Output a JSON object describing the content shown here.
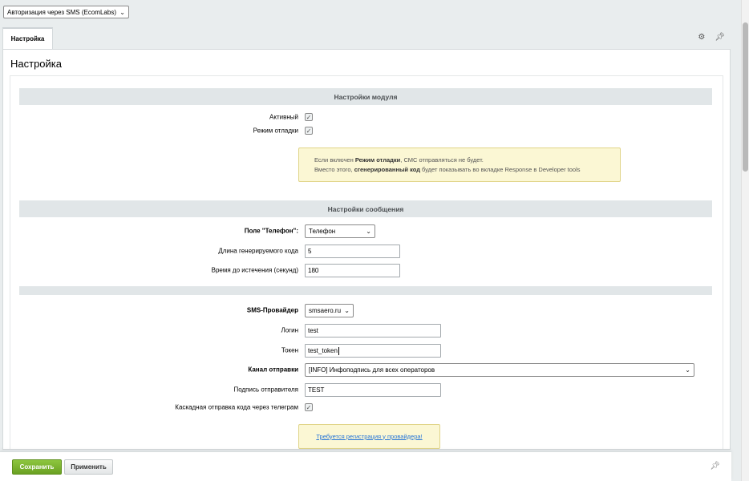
{
  "top_select": {
    "value": "Авторизация через SMS (EcomLabs)"
  },
  "tabs": [
    {
      "label": "Настройка"
    }
  ],
  "page_title": "Настройка",
  "sections": {
    "module": {
      "title": "Настройки модуля",
      "active_label": "Активный",
      "active_checked": true,
      "debug_label": "Режим отладки",
      "debug_checked": true,
      "note": {
        "line1_pre": "Если включен ",
        "line1_bold": "Режим отладки",
        "line1_post": ", СМС отправляться не будет.",
        "line2_pre": "Вместо этого, ",
        "line2_bold": "сгенерированный код",
        "line2_post": " будет показывать во вкладке Response в Developer tools"
      }
    },
    "message": {
      "title": "Настройки сообщения",
      "phone_field_label": "Поле \"Телефон\":",
      "phone_field_value": "Телефон",
      "code_length_label": "Длина генерируемого кода",
      "code_length_value": "5",
      "expire_label": "Время до истечения (секунд)",
      "expire_value": "180"
    },
    "provider": {
      "provider_label": "SMS-Провайдер",
      "provider_value": "smsaero.ru",
      "login_label": "Логин",
      "login_value": "test",
      "token_label": "Токен",
      "token_value": "test_token",
      "channel_label": "Канал отправки",
      "channel_value": "[INFO] Инфоподпись для всех операторов",
      "sender_label": "Подпись отправителя",
      "sender_value": "TEST",
      "telegram_label": "Каскадная отправка кода через телеграм",
      "telegram_checked": true,
      "note_link": "Требуется регистрация у провайдера!"
    }
  },
  "footer": {
    "save_label": "Сохранить",
    "apply_label": "Применить"
  },
  "colors": {
    "save_button": "#7bb52f",
    "note_background": "#fbf7d4",
    "section_header": "#e1e6e8",
    "link": "#2675d7"
  }
}
